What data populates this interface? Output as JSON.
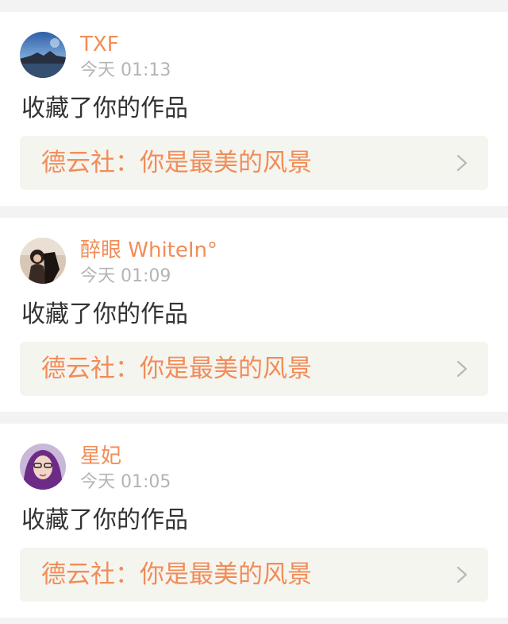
{
  "notifications": [
    {
      "avatar_icon": "avatar-landscape-icon",
      "username": "TXF",
      "time": "今天 01:13",
      "action": "收藏了你的作品",
      "work_title": "德云社：你是最美的风景"
    },
    {
      "avatar_icon": "avatar-person-icon",
      "username": "醉眼 WhiteIn°",
      "time": "今天 01:09",
      "action": "收藏了你的作品",
      "work_title": "德云社：你是最美的风景"
    },
    {
      "avatar_icon": "avatar-person-icon",
      "username": "星妃",
      "time": "今天 01:05",
      "action": "收藏了你的作品",
      "work_title": "德云社：你是最美的风景"
    }
  ],
  "colors": {
    "accent": "#f28c57",
    "muted": "#b4b4b4",
    "text": "#333333",
    "link_bg": "#f5f5f0",
    "page_bg": "#f3f3f3"
  }
}
